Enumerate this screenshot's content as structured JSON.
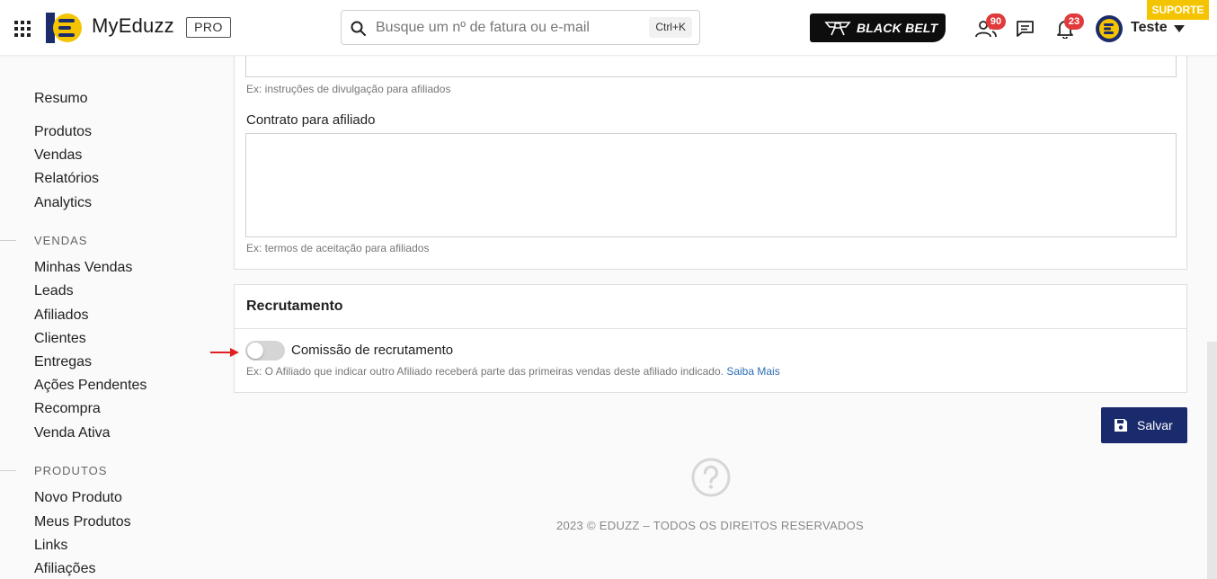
{
  "header": {
    "brand": "MyEduzz",
    "plan_badge": "PRO",
    "search_placeholder": "Busque um nº de fatura ou e-mail",
    "search_shortcut": "Ctrl+K",
    "blackbelt_label": "BLACK BELT",
    "affiliates_count": "90",
    "notifications_count": "23",
    "user_name": "Teste",
    "support_label": "SUPORTE"
  },
  "sidebar": {
    "top_items": [
      "Resumo",
      "Produtos",
      "Vendas",
      "Relatórios",
      "Analytics"
    ],
    "sections": [
      {
        "title": "VENDAS",
        "items": [
          "Minhas Vendas",
          "Leads",
          "Afiliados",
          "Clientes",
          "Entregas",
          "Ações Pendentes",
          "Recompra",
          "Venda Ativa"
        ]
      },
      {
        "title": "PRODUTOS",
        "items": [
          "Novo Produto",
          "Meus Produtos",
          "Links",
          "Afiliações"
        ]
      }
    ]
  },
  "form": {
    "instructions_help": "Ex: instruções de divulgação para afiliados",
    "contract_label": "Contrato para afiliado",
    "contract_help": "Ex: termos de aceitação para afiliados"
  },
  "recruitment": {
    "title": "Recrutamento",
    "toggle_label": "Comissão de recrutamento",
    "toggle_on": false,
    "help_text": "Ex: O Afiliado que indicar outro Afiliado receberá parte das primeiras vendas deste afiliado indicado.",
    "learn_more": "Saiba Mais"
  },
  "actions": {
    "save_label": "Salvar"
  },
  "footer": {
    "copyright": "2023 © EDUZZ – TODOS OS DIREITOS RESERVADOS"
  },
  "colors": {
    "primary": "#1a2b6d",
    "accent_yellow": "#f5c400",
    "badge_red": "#e03a3a",
    "link": "#2d6db5",
    "arrow_red": "#e02020"
  }
}
